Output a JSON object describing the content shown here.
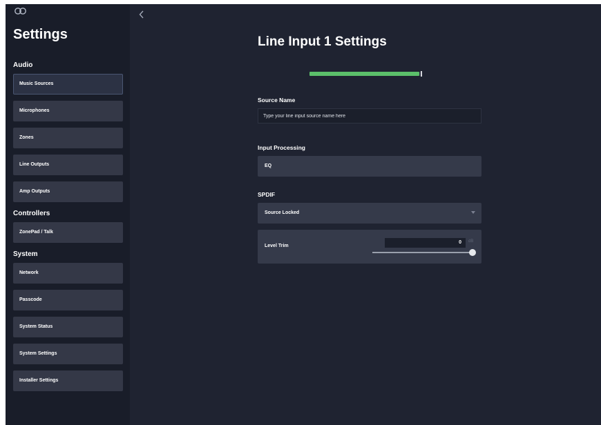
{
  "sidebar": {
    "logo_icon": "cq-logo-icon",
    "title": "Settings",
    "groups": [
      {
        "label": "Audio",
        "items": [
          "Music Sources",
          "Microphones",
          "Zones",
          "Line Outputs",
          "Amp Outputs"
        ]
      },
      {
        "label": "Controllers",
        "items": [
          "ZonePad / Talk"
        ]
      },
      {
        "label": "System",
        "items": [
          "Network",
          "Passcode",
          "System Status",
          "System Settings",
          "Installer Settings"
        ]
      }
    ],
    "active_item": "Music Sources"
  },
  "header": {
    "back_icon": "chevron-left-icon",
    "title": "Line Input 1 Settings"
  },
  "signal_meter": {
    "level": 0.98,
    "color": "#5bbf6a"
  },
  "source_name": {
    "label": "Source Name",
    "value": "",
    "placeholder": "Type your line input source name here"
  },
  "input_processing": {
    "label": "Input Processing",
    "button_label": "EQ"
  },
  "spdif": {
    "label": "SPDIF",
    "selected": "Source Locked",
    "dropdown_icon": "caret-down-icon",
    "level_trim": {
      "label": "Level Trim",
      "value": "0",
      "unit": "dB",
      "slider_fraction": 1.0
    }
  },
  "colors": {
    "app_bg": "#1f2331",
    "sidebar_bg": "#191d29",
    "button_bg": "#343847",
    "accent_green": "#5bbf6a"
  }
}
